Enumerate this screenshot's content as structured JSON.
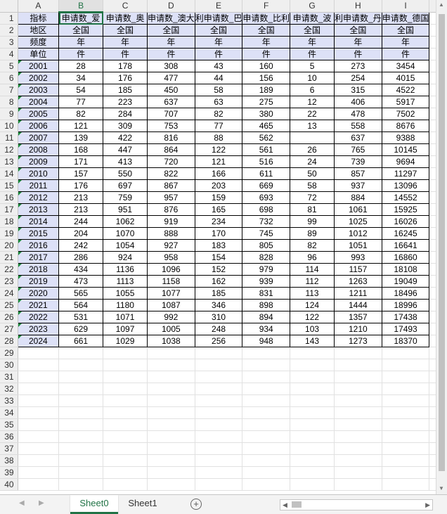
{
  "columns": [
    "A",
    "B",
    "C",
    "D",
    "E",
    "F",
    "G",
    "H",
    "I"
  ],
  "selected_column": "B",
  "header_rows": [
    [
      "指标",
      "申请数_爱",
      "申请数_奥",
      "申请数_澳大",
      "利申请数_巴",
      "申请数_比利",
      "申请数_波",
      "利申请数_丹",
      "申请数_德国"
    ],
    [
      "地区",
      "全国",
      "全国",
      "全国",
      "全国",
      "全国",
      "全国",
      "全国",
      "全国"
    ],
    [
      "频度",
      "年",
      "年",
      "年",
      "年",
      "年",
      "年",
      "年",
      "年"
    ],
    [
      "单位",
      "件",
      "件",
      "件",
      "件",
      "件",
      "件",
      "件",
      "件"
    ]
  ],
  "data_rows": [
    [
      "2001",
      "28",
      "178",
      "308",
      "43",
      "160",
      "5",
      "273",
      "3454"
    ],
    [
      "2002",
      "34",
      "176",
      "477",
      "44",
      "156",
      "10",
      "254",
      "4015"
    ],
    [
      "2003",
      "54",
      "185",
      "450",
      "58",
      "189",
      "6",
      "315",
      "4522"
    ],
    [
      "2004",
      "77",
      "223",
      "637",
      "63",
      "275",
      "12",
      "406",
      "5917"
    ],
    [
      "2005",
      "82",
      "284",
      "707",
      "82",
      "380",
      "22",
      "478",
      "7502"
    ],
    [
      "2006",
      "121",
      "309",
      "753",
      "77",
      "465",
      "13",
      "558",
      "8676"
    ],
    [
      "2007",
      "139",
      "422",
      "816",
      "88",
      "562",
      "",
      "637",
      "9388"
    ],
    [
      "2008",
      "168",
      "447",
      "864",
      "122",
      "561",
      "26",
      "765",
      "10145"
    ],
    [
      "2009",
      "171",
      "413",
      "720",
      "121",
      "516",
      "24",
      "739",
      "9694"
    ],
    [
      "2010",
      "157",
      "550",
      "822",
      "166",
      "611",
      "50",
      "857",
      "11297"
    ],
    [
      "2011",
      "176",
      "697",
      "867",
      "203",
      "669",
      "58",
      "937",
      "13096"
    ],
    [
      "2012",
      "213",
      "759",
      "957",
      "159",
      "693",
      "72",
      "884",
      "14552"
    ],
    [
      "2013",
      "213",
      "951",
      "876",
      "165",
      "698",
      "81",
      "1061",
      "15925"
    ],
    [
      "2014",
      "244",
      "1062",
      "919",
      "234",
      "732",
      "99",
      "1025",
      "16026"
    ],
    [
      "2015",
      "204",
      "1070",
      "888",
      "170",
      "745",
      "89",
      "1012",
      "16245"
    ],
    [
      "2016",
      "242",
      "1054",
      "927",
      "183",
      "805",
      "82",
      "1051",
      "16641"
    ],
    [
      "2017",
      "286",
      "924",
      "958",
      "154",
      "828",
      "96",
      "993",
      "16860"
    ],
    [
      "2018",
      "434",
      "1136",
      "1096",
      "152",
      "979",
      "114",
      "1157",
      "18108"
    ],
    [
      "2019",
      "473",
      "1113",
      "1158",
      "162",
      "939",
      "112",
      "1263",
      "19049"
    ],
    [
      "2020",
      "565",
      "1055",
      "1077",
      "185",
      "831",
      "113",
      "1211",
      "18496"
    ],
    [
      "2021",
      "564",
      "1180",
      "1087",
      "346",
      "898",
      "124",
      "1444",
      "18996"
    ],
    [
      "2022",
      "531",
      "1071",
      "992",
      "310",
      "894",
      "122",
      "1357",
      "17438"
    ],
    [
      "2023",
      "629",
      "1097",
      "1005",
      "248",
      "934",
      "103",
      "1210",
      "17493"
    ],
    [
      "2024",
      "661",
      "1029",
      "1038",
      "256",
      "948",
      "143",
      "1273",
      "18370"
    ]
  ],
  "total_rows": 40,
  "sheets": [
    {
      "name": "Sheet0",
      "active": true
    },
    {
      "name": "Sheet1",
      "active": false
    }
  ],
  "add_sheet_symbol": "+"
}
